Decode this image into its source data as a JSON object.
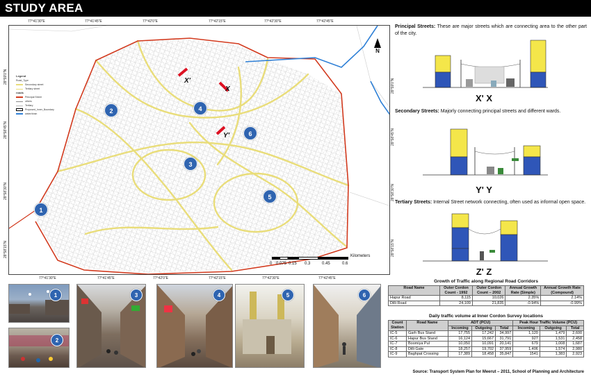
{
  "title": "STUDY AREA",
  "map": {
    "top_coords": [
      "77°41'30\"E",
      "77°41'45\"E",
      "77°42'0\"E",
      "77°42'15\"E",
      "77°42'30\"E",
      "77°42'45\"E"
    ],
    "bottom_coords": [
      "77°41'30\"E",
      "77°41'45\"E",
      "77°42'0\"E",
      "77°42'15\"E",
      "77°42'30\"E",
      "77°42'45\"E"
    ],
    "left_coords": [
      "28°59'0\"N",
      "28°58'45\"N",
      "28°58'30\"N",
      "28°58'15\"N"
    ],
    "right_coords": [
      "28°59'0\"N",
      "28°58'45\"N",
      "28°58'30\"N",
      "28°58'15\"N"
    ],
    "legend": {
      "heading": "Legend",
      "road_type": "Road_Type",
      "items": [
        "Secondary street",
        "Tertiary street"
      ],
      "roads_heading": "roads",
      "more_items": [
        "Principal Street",
        "others",
        "Tertiary",
        "Proposed_Inner_Boundary",
        "water/drain"
      ]
    },
    "markers": [
      "1",
      "2",
      "3",
      "4",
      "5",
      "6"
    ],
    "section_labels": [
      "X'",
      "X",
      "Y'",
      "Y"
    ],
    "north": "N",
    "scale_ticks": [
      "0",
      "0.075",
      "0.15",
      "0.3",
      "0.45",
      "0.6"
    ],
    "scale_unit": "Kilometers"
  },
  "street_types": [
    {
      "name": "Principal Streets:",
      "desc": " These are major streets which are connecting area to the other part of the city.",
      "section": "X' X"
    },
    {
      "name": "Secondary Streets:",
      "desc": " Majorly connecting principal streets and different wards.",
      "section": "Y' Y"
    },
    {
      "name": "Tertiary Streets:",
      "desc": " Internal Street network connecting, often used as informal open space.",
      "section": "Z' Z"
    }
  ],
  "photos": [
    "1",
    "2",
    "3",
    "4",
    "5",
    "6"
  ],
  "colors": {
    "marker": "#2f64b0",
    "boundary": "#d23a1e",
    "water": "#2d7fd6",
    "street": "#e9dd7a"
  },
  "growth_table": {
    "title": "Growth of Traffic along Regional Road Corridors",
    "headers": [
      "Road Name",
      "Outer Cordon Count - 1992",
      "Outer Cordon Count – 2002",
      "Annual Growth Rate (Simple)",
      "Annual Growth Rate (Compound)"
    ],
    "rows": [
      [
        "Hapur Road",
        "8,115",
        "10,026",
        "2.35%",
        "2.14%"
      ],
      [
        "Dilli Road",
        "24,109",
        "21,835",
        "-0.94%",
        "-0.99%"
      ]
    ]
  },
  "volume_table": {
    "title": "Daily traffic volume at Inner Cordon Survey locations",
    "h_count": "Count Station",
    "h_road": "Road Name",
    "h_adt": "ADT (PCU)",
    "h_peak": "Peak Hour Traffic Volume (PCU)",
    "sub": [
      "Incoming",
      "Outgoing",
      "Total",
      "Incoming",
      "Outgoing",
      "Total"
    ],
    "rows": [
      [
        "IC-5",
        "Garh Bus Stand",
        "17,755",
        "17,242",
        "34,997",
        "1,120",
        "1,479",
        "2,600"
      ],
      [
        "IC-6",
        "Hapur Bus Stand",
        "16,124",
        "15,667",
        "31,791",
        "927",
        "1,531",
        "2,458"
      ],
      [
        "IC-7",
        "Boomiya Pul",
        "10,050",
        "10,091",
        "20,141",
        "679",
        "1,008",
        "1,687"
      ],
      [
        "IC-8",
        "Dilli Gate",
        "18,257",
        "19,702",
        "37,959",
        "1,406",
        "1,574",
        "2,980"
      ],
      [
        "IC-9",
        "Baghpat Crossing",
        "17,389",
        "18,458",
        "35,847",
        "1541",
        "1,383",
        "2,923"
      ]
    ]
  },
  "source": "Source: Transport System Plan for Meerut – 2011, School of Planning and Architecture"
}
